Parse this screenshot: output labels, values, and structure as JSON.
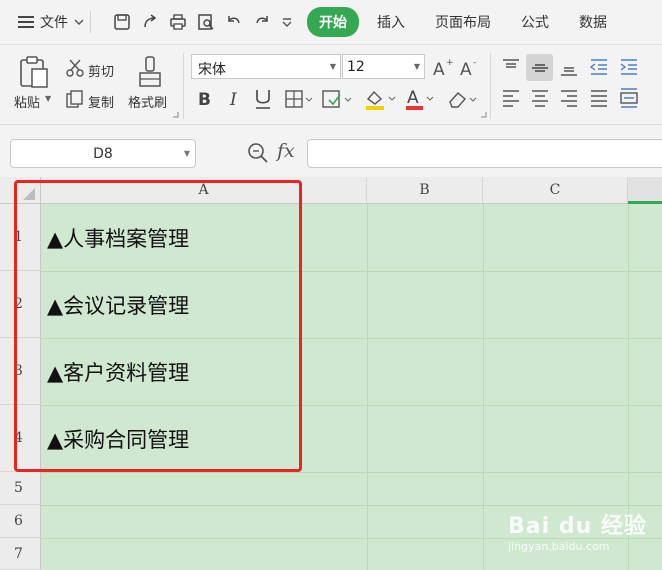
{
  "menu": {
    "file_label": "文件"
  },
  "tabs": [
    {
      "label": "开始",
      "active": true
    },
    {
      "label": "插入"
    },
    {
      "label": "页面布局"
    },
    {
      "label": "公式"
    },
    {
      "label": "数据"
    }
  ],
  "ribbon": {
    "paste_label": "粘贴",
    "cut_label": "剪切",
    "copy_label": "复制",
    "format_painter_label": "格式刷",
    "font_name": "宋体",
    "font_size": "12"
  },
  "formula_bar": {
    "name_box": "D8",
    "fx_label": "fx",
    "value": ""
  },
  "columns": [
    "A",
    "B",
    "C"
  ],
  "rows": [
    {
      "num": "1",
      "a": "▲人事档案管理"
    },
    {
      "num": "2",
      "a": "▲会议记录管理"
    },
    {
      "num": "3",
      "a": "▲客户资料管理"
    },
    {
      "num": "4",
      "a": "▲采购合同管理"
    },
    {
      "num": "5",
      "a": ""
    },
    {
      "num": "6",
      "a": ""
    },
    {
      "num": "7",
      "a": ""
    }
  ],
  "watermark": {
    "brand": "Bai du 经验",
    "url": "jingyan.baidu.com"
  },
  "colors": {
    "accent": "#35a853",
    "grid_bg": "#cfe8cf",
    "highlight_border": "#e8261f",
    "font_color_underline": "#e33",
    "fill_underline": "#f5d000"
  }
}
